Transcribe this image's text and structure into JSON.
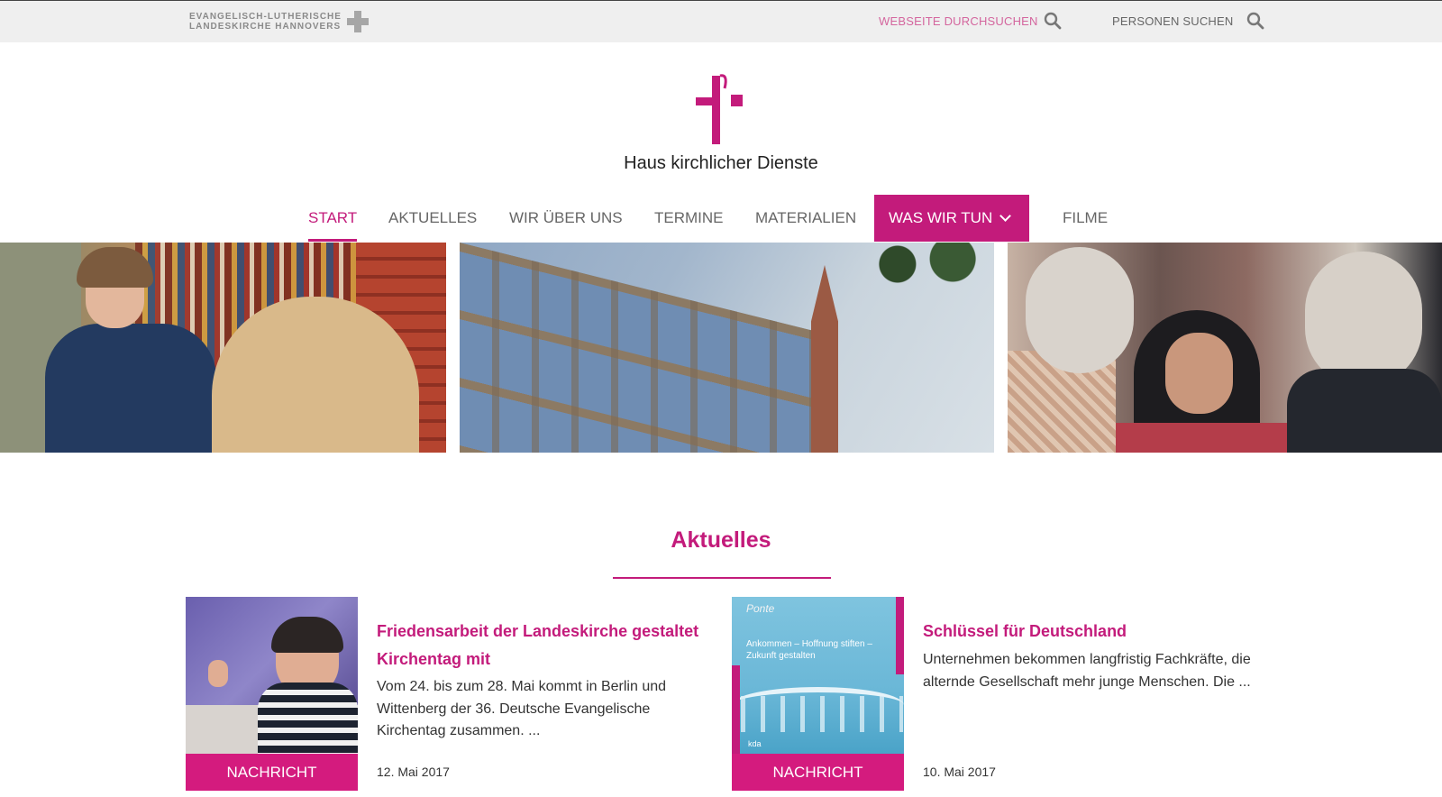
{
  "topbar": {
    "church_logo_line1": "EVANGELISCH-LUTHERISCHE",
    "church_logo_line2": "LANDESKIRCHE HANNOVERS",
    "search_site_label": "WEBSEITE DURCHSUCHEN",
    "search_persons_label": "PERSONEN SUCHEN",
    "icons": [
      "search-icon",
      "search-icon"
    ]
  },
  "brand": {
    "name": "Haus kirchlicher Dienste",
    "logo_icon": "cross-logo-icon",
    "color": "#c31b7b"
  },
  "nav": {
    "items": [
      {
        "label": "START",
        "state": "active"
      },
      {
        "label": "AKTUELLES"
      },
      {
        "label": "WIR ÜBER UNS"
      },
      {
        "label": "TERMINE"
      },
      {
        "label": "MATERIALIEN"
      },
      {
        "label": "WAS WIR TUN",
        "state": "highlighted",
        "icon": "chevron-down-icon"
      },
      {
        "label": "FILME"
      }
    ]
  },
  "section": {
    "title": "Aktuelles"
  },
  "news": [
    {
      "tag": "NACHRICHT",
      "title": "Friedensarbeit der Landeskirche gestaltet Kirchentag mit",
      "text": "Vom 24. bis zum 28. Mai kommt in Berlin und Wittenberg der 36. Deutsche Evangelische Kirchentag zusammen. ...",
      "date": "12. Mai 2017"
    },
    {
      "tag": "NACHRICHT",
      "title": "Schlüssel für Deutschland",
      "text": "Unternehmen bekommen langfristig Fachkräfte, die alternde Gesellschaft mehr junge Menschen. Die ...",
      "date": "10. Mai 2017",
      "image_text": {
        "heading": "Ankommen – Hoffnung stiften – Zukunft gestalten",
        "brand": "Ponte",
        "footer": "kda"
      }
    }
  ],
  "colors": {
    "accent": "#c31b7b",
    "tag_bg": "#d41b7e",
    "topbar_bg": "#efefef"
  }
}
